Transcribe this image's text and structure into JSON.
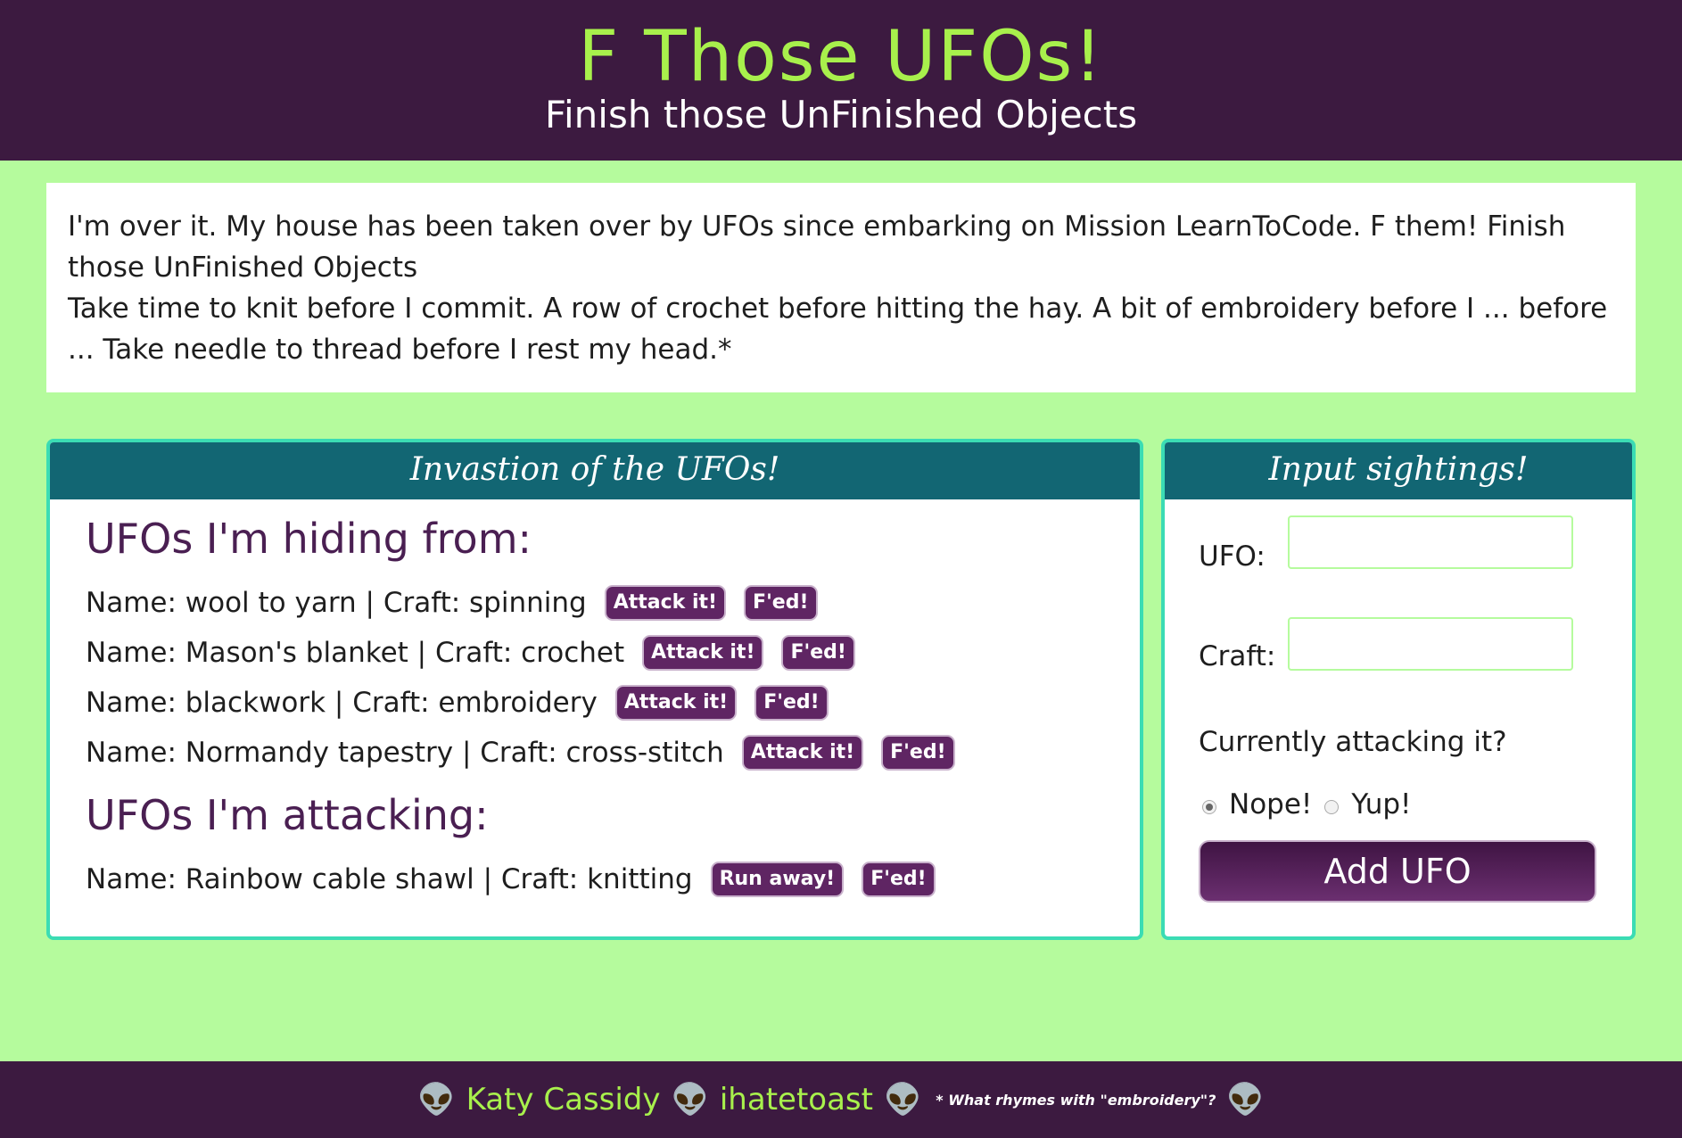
{
  "header": {
    "title": "F Those UFOs!",
    "subtitle": "Finish those UnFinished Objects"
  },
  "intro": {
    "line1": "I'm over it. My house has been taken over by UFOs since embarking on Mission LearnToCode. F them! Finish those UnFinished Objects",
    "line2": "Take time to knit before I commit. A row of crochet before hitting the hay. A bit of embroidery before I ... before ... Take needle to thread before I rest my head.*"
  },
  "invasion": {
    "panel_title": "Invastion of the UFOs!",
    "hiding_title": "UFOs I'm hiding from:",
    "hiding": [
      {
        "text": "Name: wool to yarn | Craft: spinning",
        "attack": "Attack it!",
        "fed": "F'ed!"
      },
      {
        "text": "Name: Mason's blanket | Craft: crochet",
        "attack": "Attack it!",
        "fed": "F'ed!"
      },
      {
        "text": "Name: blackwork | Craft: embroidery",
        "attack": "Attack it!",
        "fed": "F'ed!"
      },
      {
        "text": "Name: Normandy tapestry | Craft: cross-stitch",
        "attack": "Attack it!",
        "fed": "F'ed!"
      }
    ],
    "attacking_title": "UFOs I'm attacking:",
    "attacking": [
      {
        "text": "Name: Rainbow cable shawl | Craft: knitting",
        "run": "Run away!",
        "fed": "F'ed!"
      }
    ]
  },
  "form": {
    "panel_title": "Input sightings!",
    "ufo_label": "UFO:",
    "ufo_value": "",
    "craft_label": "Craft:",
    "craft_value": "",
    "attacking_question": "Currently attacking it?",
    "option_no": "Nope!",
    "option_yes": "Yup!",
    "selected": "Nope!",
    "submit_label": "Add UFO"
  },
  "footer": {
    "author": "Katy Cassidy",
    "handle": "ihatetoast",
    "note": "* What rhymes with \"embroidery\"?",
    "icon": "alien-icon"
  },
  "colors": {
    "header_bg": "#3c1a40",
    "page_bg": "#b5fb9d",
    "title_green": "#a8f04c",
    "panel_head": "#126673",
    "panel_border": "#3bdcb4",
    "button_purple": "#5f2563"
  }
}
